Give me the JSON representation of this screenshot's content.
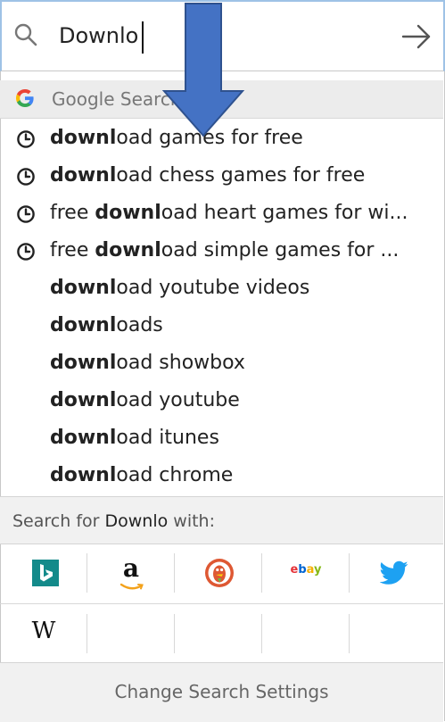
{
  "search": {
    "value": "Downlo"
  },
  "engine_header": {
    "label": "Google Search"
  },
  "suggestions": [
    {
      "bold": "downl",
      "rest": "oad games for free",
      "prefix": "",
      "history": true
    },
    {
      "bold": "downl",
      "rest": "oad chess games for free",
      "prefix": "",
      "history": true
    },
    {
      "bold": "downl",
      "rest": "oad heart games for wi...",
      "prefix": "free ",
      "history": true
    },
    {
      "bold": "downl",
      "rest": "oad simple games for ...",
      "prefix": "free ",
      "history": true
    },
    {
      "bold": "downl",
      "rest": "oad youtube videos",
      "prefix": "",
      "history": false
    },
    {
      "bold": "downl",
      "rest": "oads",
      "prefix": "",
      "history": false
    },
    {
      "bold": "downl",
      "rest": "oad showbox",
      "prefix": "",
      "history": false
    },
    {
      "bold": "downl",
      "rest": "oad youtube",
      "prefix": "",
      "history": false
    },
    {
      "bold": "downl",
      "rest": "oad itunes",
      "prefix": "",
      "history": false
    },
    {
      "bold": "downl",
      "rest": "oad chrome",
      "prefix": "",
      "history": false
    }
  ],
  "search_for": {
    "prefix": "Search for ",
    "term": "Downlo",
    "suffix": " with:"
  },
  "engines": {
    "amazon_glyph": "a",
    "ebay_letters": [
      "e",
      "b",
      "a",
      "y"
    ],
    "wiki_glyph": "W"
  },
  "settings": {
    "label": "Change Search Settings"
  },
  "colors": {
    "bing": "#138a8a",
    "twitter": "#1da1f2",
    "annotation_arrow": "#4472c4",
    "ebay": [
      "#e53238",
      "#0064d2",
      "#f5af02",
      "#86b817"
    ]
  }
}
